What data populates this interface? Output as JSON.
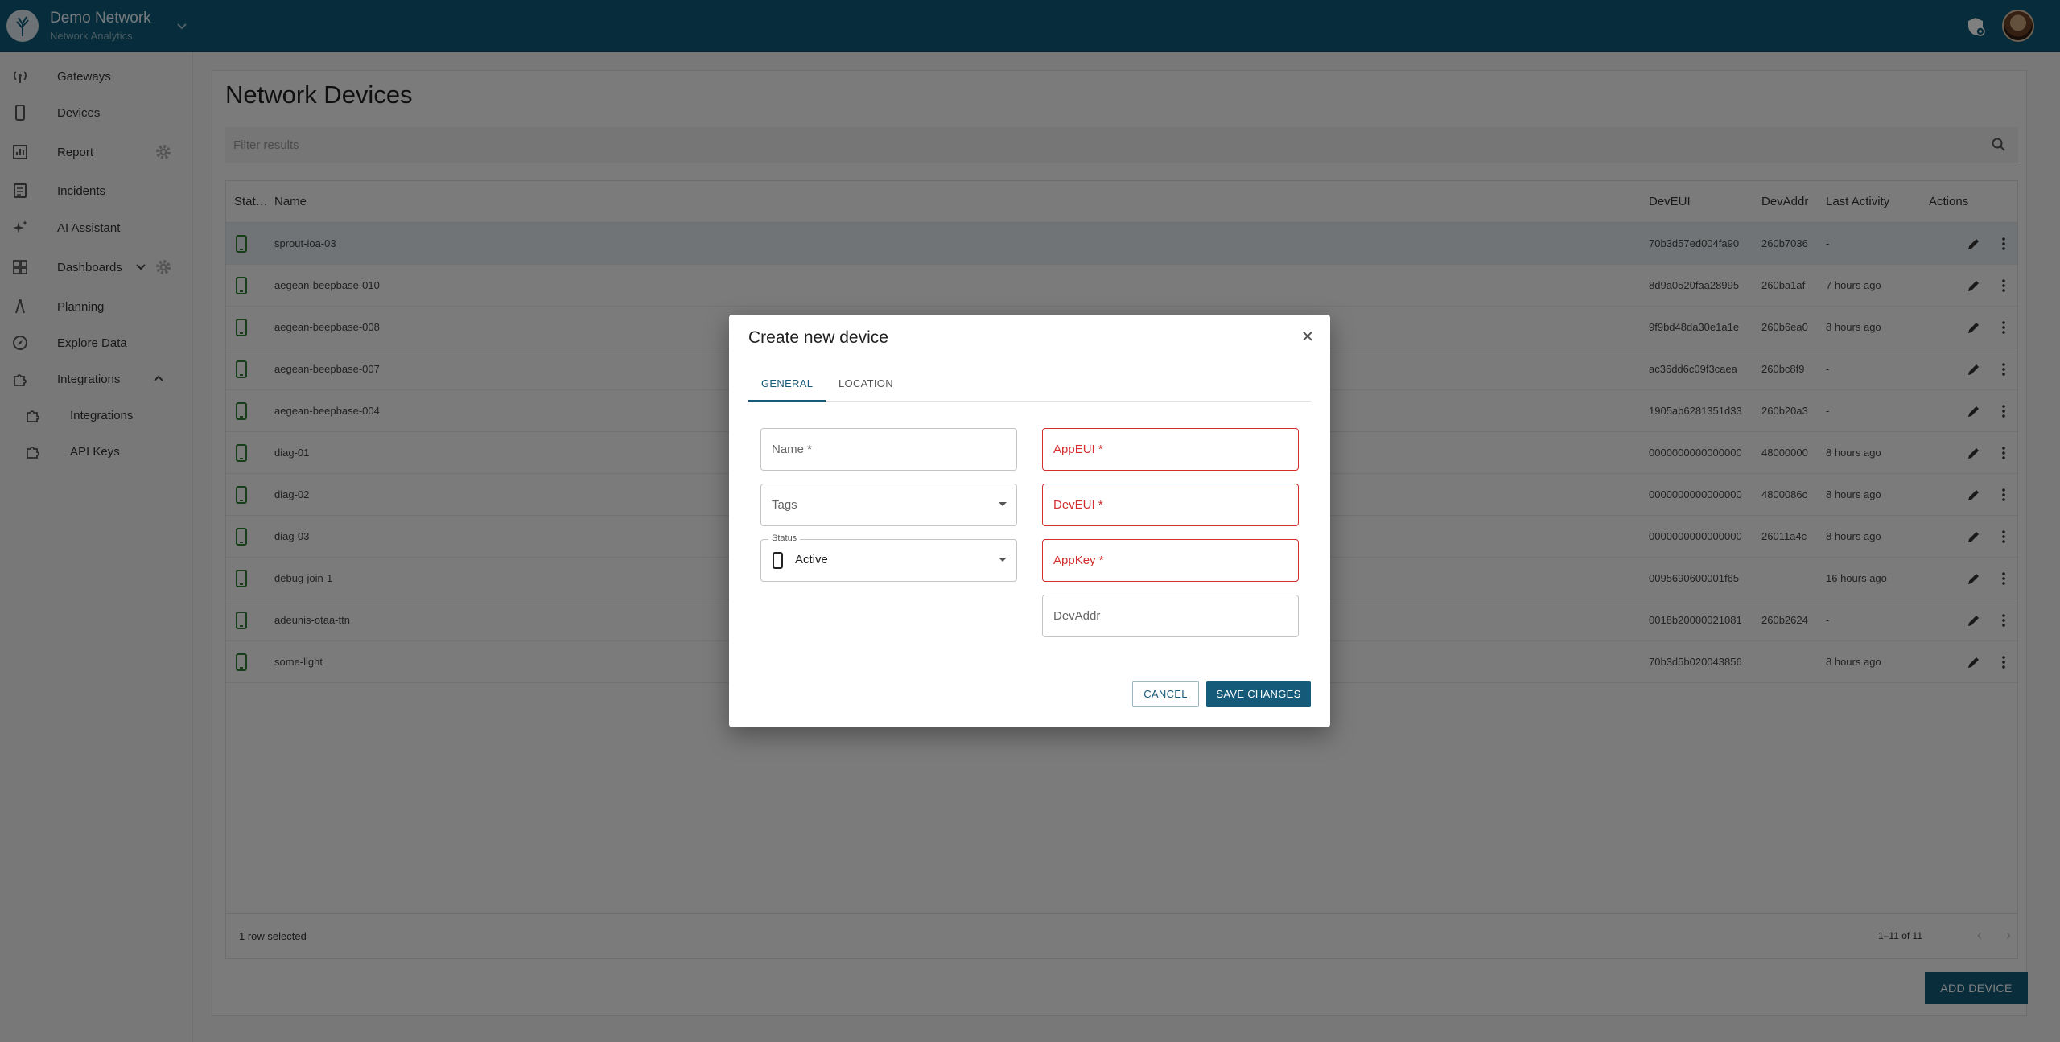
{
  "header": {
    "org_name": "Demo Network",
    "org_sub": "Network Analytics",
    "colors": {
      "primary": "#0f5a78",
      "accent": "#155a78",
      "error": "#d32f2f",
      "ok": "#2e7d32"
    }
  },
  "sidebar": {
    "items": [
      {
        "label": "Gateways",
        "icon": "gateway-icon"
      },
      {
        "label": "Devices",
        "icon": "device-icon"
      },
      {
        "label": "Report",
        "icon": "report-icon"
      },
      {
        "label": "Incidents",
        "icon": "incidents-icon"
      },
      {
        "label": "AI Assistant",
        "icon": "sparkle-icon"
      },
      {
        "label": "Dashboards",
        "icon": "dashboard-icon"
      },
      {
        "label": "Planning",
        "icon": "planning-icon"
      },
      {
        "label": "Explore Data",
        "icon": "compass-icon"
      },
      {
        "label": "Integrations",
        "icon": "puzzle-icon"
      },
      {
        "label": "Integrations",
        "icon": "puzzle-icon"
      },
      {
        "label": "API Keys",
        "icon": "key-icon"
      }
    ]
  },
  "page": {
    "title": "Network Devices",
    "filter_placeholder": "Filter results",
    "add_label": "ADD DEVICE"
  },
  "table": {
    "columns": [
      "Stat…",
      "Name",
      "DevEUI",
      "DevAddr",
      "Last Activity",
      "Actions"
    ],
    "rows": [
      {
        "name": "sprout-ioa-03",
        "deveui": "70b3d57ed004fa90",
        "devaddr": "260b7036",
        "last": "-"
      },
      {
        "name": "aegean-beepbase-010",
        "deveui": "8d9a0520faa28995",
        "devaddr": "260ba1af",
        "last": "7 hours ago"
      },
      {
        "name": "aegean-beepbase-008",
        "deveui": "9f9bd48da30e1a1e",
        "devaddr": "260b6ea0",
        "last": "8 hours ago"
      },
      {
        "name": "aegean-beepbase-007",
        "deveui": "ac36dd6c09f3caea",
        "devaddr": "260bc8f9",
        "last": "-"
      },
      {
        "name": "aegean-beepbase-004",
        "deveui": "1905ab6281351d33",
        "devaddr": "260b20a3",
        "last": "-"
      },
      {
        "name": "diag-01",
        "deveui": "0000000000000000",
        "devaddr": "48000000",
        "last": "8 hours ago"
      },
      {
        "name": "diag-02",
        "deveui": "0000000000000000",
        "devaddr": "4800086c",
        "last": "8 hours ago"
      },
      {
        "name": "diag-03",
        "deveui": "0000000000000000",
        "devaddr": "26011a4c",
        "last": "8 hours ago"
      },
      {
        "name": "debug-join-1",
        "deveui": "0095690600001f65",
        "devaddr": "",
        "last": "16 hours ago"
      },
      {
        "name": "adeunis-otaa-ttn",
        "deveui": "0018b20000021081",
        "devaddr": "260b2624",
        "last": "-"
      },
      {
        "name": "some-light",
        "deveui": "70b3d5b020043856",
        "devaddr": "",
        "last": "8 hours ago"
      }
    ],
    "footer_selected": "1 row selected",
    "footer_range": "1–11 of 11"
  },
  "dialog": {
    "title": "Create new device",
    "tabs": [
      "GENERAL",
      "LOCATION"
    ],
    "fields": {
      "name": "Name *",
      "tags": "Tags",
      "status_label": "Status",
      "status_value": "Active",
      "appeui": "AppEUI *",
      "deveui": "DevEUI *",
      "appkey": "AppKey *",
      "devaddr": "DevAddr"
    },
    "cancel": "CANCEL",
    "save": "SAVE CHANGES"
  }
}
